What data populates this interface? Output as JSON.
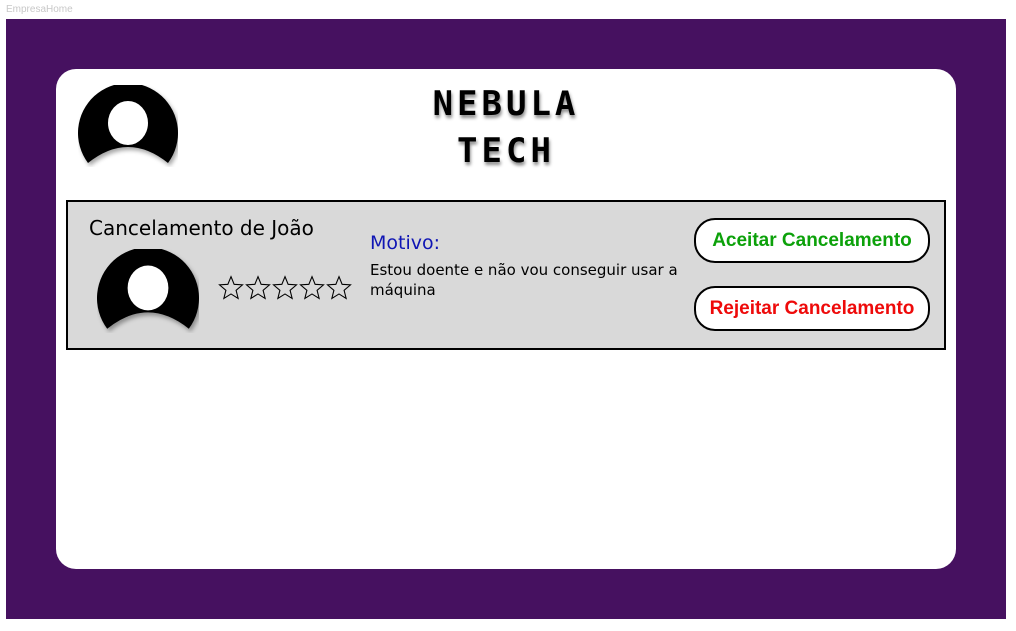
{
  "frame": {
    "label": "EmpresaHome",
    "background": "#461160"
  },
  "header": {
    "avatar_icon": "user-avatar-icon",
    "logo_line1": "NEBULA",
    "logo_line2": "TECH"
  },
  "request": {
    "title": "Cancelamento de João",
    "avatar_icon": "user-avatar-icon",
    "rating": 0,
    "rating_max": 5,
    "star_icon": "star-outline-icon",
    "reason_label": "Motivo:",
    "reason_text": "Estou doente e não vou conseguir usar a máquina",
    "accept_label": "Aceitar Cancelamento",
    "reject_label": "Rejeitar Cancelamento"
  },
  "colors": {
    "accent_purple": "#461160",
    "accept_green": "#0ca10a",
    "reject_red": "#ee0a0a",
    "reason_blue": "#0f15b4",
    "request_panel": "#d9d9d9"
  }
}
